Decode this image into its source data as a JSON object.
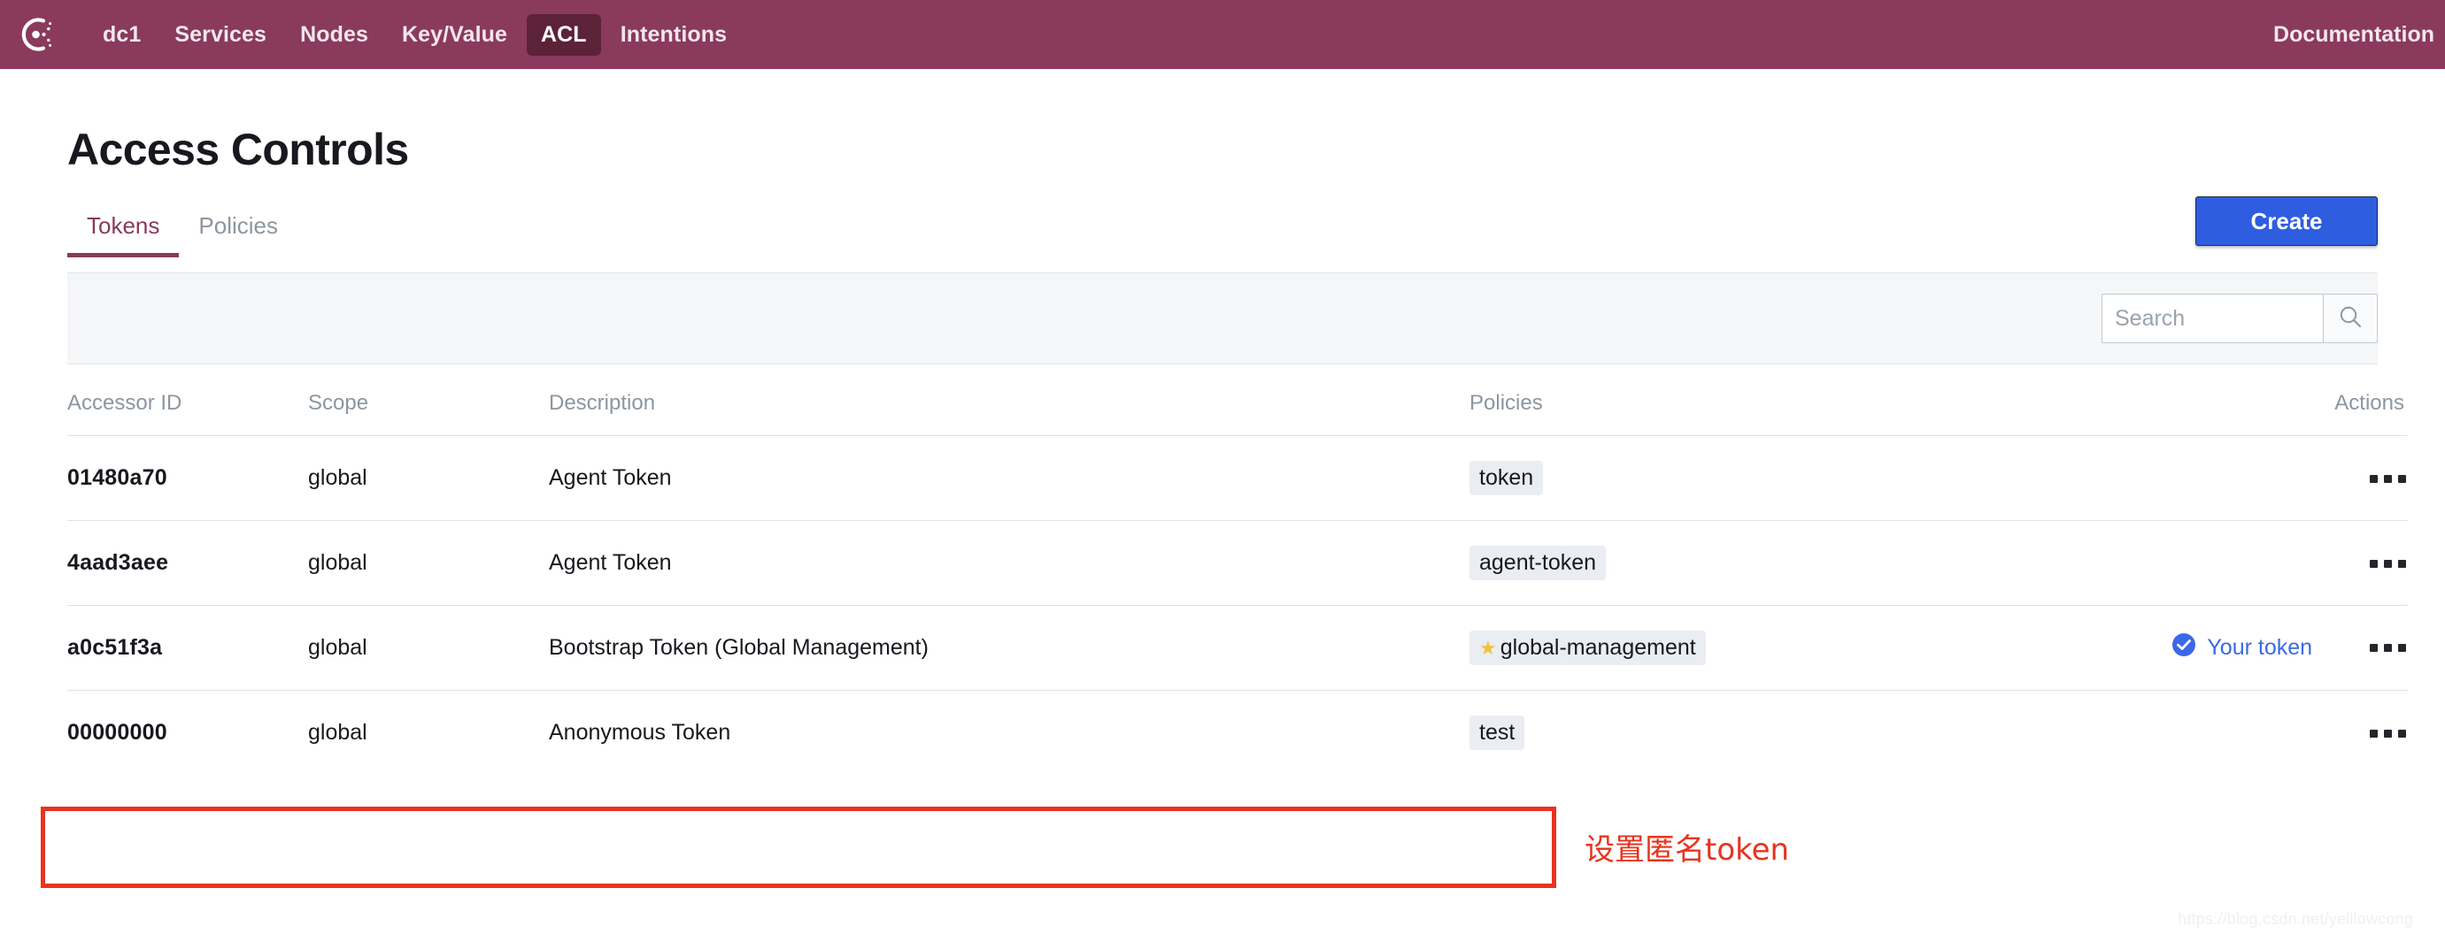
{
  "navbar": {
    "logo_icon": "consul-logo-icon",
    "links": [
      {
        "label": "dc1",
        "active": false
      },
      {
        "label": "Services",
        "active": false
      },
      {
        "label": "Nodes",
        "active": false
      },
      {
        "label": "Key/Value",
        "active": false
      },
      {
        "label": "ACL",
        "active": true
      },
      {
        "label": "Intentions",
        "active": false
      }
    ],
    "documentation_label": "Documentation",
    "background_color": "#8a3a5c",
    "active_pill_color": "#5c2238"
  },
  "page": {
    "title": "Access Controls"
  },
  "tabs": [
    {
      "label": "Tokens",
      "active": true
    },
    {
      "label": "Policies",
      "active": false
    }
  ],
  "toolbar": {
    "create_label": "Create",
    "create_color": "#2f5de0"
  },
  "search": {
    "value": "",
    "placeholder": "Search",
    "icon": "search-icon"
  },
  "table": {
    "headers": {
      "accessor_id": "Accessor ID",
      "scope": "Scope",
      "description": "Description",
      "policies": "Policies",
      "actions": "Actions"
    },
    "rows": [
      {
        "accessor_id": "01480a70",
        "scope": "global",
        "description": "Agent Token",
        "policies": [
          {
            "label": "token",
            "starred": false
          }
        ],
        "your_token": false,
        "your_token_label": "",
        "kebab": "more-actions-icon"
      },
      {
        "accessor_id": "4aad3aee",
        "scope": "global",
        "description": "Agent Token",
        "policies": [
          {
            "label": "agent-token",
            "starred": false
          }
        ],
        "your_token": false,
        "your_token_label": "",
        "kebab": "more-actions-icon"
      },
      {
        "accessor_id": "a0c51f3a",
        "scope": "global",
        "description": "Bootstrap Token (Global Management)",
        "policies": [
          {
            "label": "global-management",
            "starred": true
          }
        ],
        "your_token": true,
        "your_token_label": "Your token",
        "kebab": "more-actions-icon"
      },
      {
        "accessor_id": "00000000",
        "scope": "global",
        "description": "Anonymous Token",
        "policies": [
          {
            "label": "test",
            "starred": false
          }
        ],
        "your_token": false,
        "your_token_label": "",
        "kebab": "more-actions-icon"
      }
    ],
    "star_color": "#f2c13c",
    "your_token_color": "#3b68e8"
  },
  "annotations": {
    "highlight_color": "#e8331f",
    "note_text": "设置匿名token"
  },
  "watermark": {
    "text": "https://blog.csdn.net/yelllowcong"
  }
}
